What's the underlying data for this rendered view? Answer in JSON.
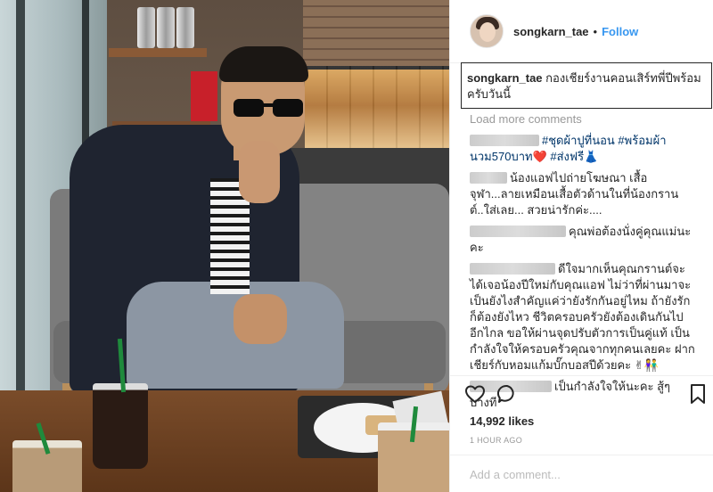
{
  "header": {
    "username": "songkarn_tae",
    "separator": "•",
    "follow_label": "Follow"
  },
  "caption": {
    "username": "songkarn_tae",
    "text": "กองเชียร์งานคอนเสิร์ทพี่ปีพร้อมครับวันนี้"
  },
  "load_more_label": "Load more comments",
  "comments": [
    {
      "text": "#ชุดผ้าปูที่นอน #พร้อมผ้านวม570บาท❤️ #ส่งฟรี👗"
    },
    {
      "text": "น้องแอฟไปถ่ายโฆษณา เสื้อ จุฬา...ลายเหมือนเสื้อตัวด้านในที่น้องกรานต์..ใส่เลย... สวยน่ารักค่ะ...."
    },
    {
      "text": "คุณพ่อต้องนั่งคู่คุณแม่นะคะ"
    },
    {
      "text": "ดีใจมากเห็นคุณกรานต์จะได้เจอน้องปีใหม่กับคุณแอฟ ไม่ว่าที่ผ่านมาจะเป็นยังไงสำคัญแค่ว่ายังรักกันอยู่ไหม ถ้ายังรักก็ต้องยังไหว ชีวิตครอบครัวยังต้องเดินกันไปอีกไกล ขอให้ผ่านจุดปรับตัวการเป็นคู่แท้ เป็นกำลังใจให้ครอบครัวคุณจากทุกคนเลยคะ ฝากเชียร์กับหอมแก้มบั๊กบอสปีด้วยคะ ✌👫"
    },
    {
      "text": "เป็นกำลังใจให้นะคะ สู้ๆ บางที"
    }
  ],
  "stats": {
    "likes": "14,992 likes",
    "time": "1 HOUR AGO"
  },
  "composer": {
    "placeholder": "Add a comment..."
  },
  "icons": {
    "like": "heart-icon",
    "comment": "comment-icon",
    "save": "bookmark-icon"
  },
  "colors": {
    "link": "#3897f0",
    "text": "#262626",
    "muted": "#999999"
  }
}
